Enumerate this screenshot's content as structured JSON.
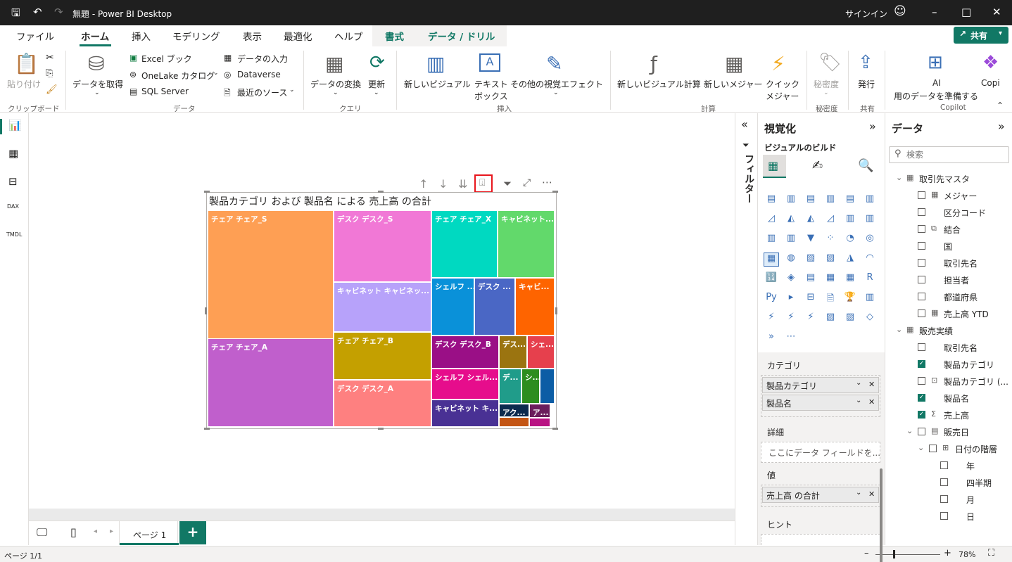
{
  "titlebar": {
    "title": "無題 - Power BI Desktop",
    "signin": "サインイン"
  },
  "menu": {
    "tabs": [
      "ファイル",
      "ホーム",
      "挿入",
      "モデリング",
      "表示",
      "最適化",
      "ヘルプ",
      "書式",
      "データ / ドリル"
    ],
    "share": "共有"
  },
  "ribbon": {
    "clipboard": {
      "paste": "貼り付け",
      "group": "クリップボード"
    },
    "data": {
      "get_data": "データを取得",
      "excel": "Excel ブック",
      "onelake": "OneLake カタログ",
      "sql": "SQL Server",
      "enter": "データの入力",
      "dataverse": "Dataverse",
      "recent": "最近のソース",
      "group": "データ"
    },
    "query": {
      "transform": "データの変換",
      "refresh": "更新",
      "group": "クエリ"
    },
    "insert": {
      "new_visual": "新しいビジュアル",
      "textbox_1": "テキスト",
      "textbox_2": "ボックス",
      "more_visuals": "その他の視覚エフェクト",
      "group": "挿入"
    },
    "calc": {
      "new_calc": "新しいビジュアル計算",
      "new_measure": "新しいメジャー",
      "quick_1": "クイック",
      "quick_2": "メジャー",
      "group": "計算"
    },
    "sens": {
      "label": "秘密度",
      "group": "秘密度"
    },
    "share": {
      "publish": "発行",
      "group": "共有"
    },
    "copilot": {
      "ai_1": "AI",
      "ai_2": "用のデータを準備する",
      "copilot": "Copi",
      "group": "Copilot"
    }
  },
  "visual": {
    "title": "製品カテゴリ および 製品名 による 売上高 の合計"
  },
  "chart_data": {
    "type": "treemap",
    "title": "製品カテゴリ および 製品名 による 売上高 の合計",
    "tiles": [
      {
        "label": "チェア チェア_S",
        "color": "#fe9f54"
      },
      {
        "label": "チェア チェア_A",
        "color": "#c05fcc"
      },
      {
        "label": "デスク デスク_S",
        "color": "#f178d6"
      },
      {
        "label": "キャビネット キャビネッ...",
        "color": "#b7a2fa"
      },
      {
        "label": "チェア チェア_B",
        "color": "#c4a000"
      },
      {
        "label": "デスク デスク_A",
        "color": "#fe8080"
      },
      {
        "label": "チェア チェア_X",
        "color": "#00d9c1"
      },
      {
        "label": "キャビネット...",
        "color": "#62d96b"
      },
      {
        "label": "シェルフ ...",
        "color": "#0a91d9"
      },
      {
        "label": "デスク ...",
        "color": "#4a67c5"
      },
      {
        "label": "キャビ...",
        "color": "#fe6400"
      },
      {
        "label": "デスク デスク_B",
        "color": "#9a0f86"
      },
      {
        "label": "デス...",
        "color": "#9b7410"
      },
      {
        "label": "シェ...",
        "color": "#e6404d"
      },
      {
        "label": "シェルフ シェル...",
        "color": "#e60d8c"
      },
      {
        "label": "デ...",
        "color": "#209c8a"
      },
      {
        "label": "シ...",
        "color": "#2d8d1f"
      },
      {
        "label": "",
        "color": "#0c5da5"
      },
      {
        "label": "キャビネット キ...",
        "color": "#493194"
      },
      {
        "label": "アク...",
        "color": "#0c2a4e"
      },
      {
        "label": "ア...",
        "color": "#6b1d5c"
      },
      {
        "label": "",
        "color": "#c45514"
      },
      {
        "label": "",
        "color": "#b91383"
      }
    ]
  },
  "filters": {
    "label": "フィルター"
  },
  "viz": {
    "title": "視覚化",
    "build": "ビジュアルのビルド",
    "category_label": "カテゴリ",
    "fields": [
      "製品カテゴリ",
      "製品名"
    ],
    "details_label": "詳細",
    "details_placeholder": "ここにデータ フィールドを...",
    "values_label": "値",
    "value_field": "売上高 の合計",
    "tooltip_label": "ヒント"
  },
  "data": {
    "title": "データ",
    "search_placeholder": "検索",
    "tables": [
      {
        "name": "取引先マスタ",
        "fields": [
          {
            "name": "メジャー",
            "checked": false,
            "glyph": "▦"
          },
          {
            "name": "区分コード",
            "checked": false,
            "glyph": ""
          },
          {
            "name": "結合",
            "checked": false,
            "glyph": "⧉"
          },
          {
            "name": "国",
            "checked": false,
            "glyph": ""
          },
          {
            "name": "取引先名",
            "checked": false,
            "glyph": ""
          },
          {
            "name": "担当者",
            "checked": false,
            "glyph": ""
          },
          {
            "name": "都道府県",
            "checked": false,
            "glyph": ""
          },
          {
            "name": "売上高 YTD",
            "checked": false,
            "glyph": "▦"
          }
        ]
      },
      {
        "name": "販売実績",
        "fields": [
          {
            "name": "取引先名",
            "checked": false,
            "glyph": ""
          },
          {
            "name": "製品カテゴリ",
            "checked": true,
            "glyph": ""
          },
          {
            "name": "製品カテゴリ (...",
            "checked": false,
            "glyph": "⊡"
          },
          {
            "name": "製品名",
            "checked": true,
            "glyph": ""
          },
          {
            "name": "売上高",
            "checked": true,
            "glyph": "Σ"
          },
          {
            "name": "販売日",
            "checked": false,
            "glyph": "▤"
          },
          {
            "name": "日付の階層",
            "checked": false,
            "glyph": "⊞"
          },
          {
            "name": "年",
            "checked": false,
            "glyph": ""
          },
          {
            "name": "四半期",
            "checked": false,
            "glyph": ""
          },
          {
            "name": "月",
            "checked": false,
            "glyph": ""
          },
          {
            "name": "日",
            "checked": false,
            "glyph": ""
          }
        ]
      }
    ]
  },
  "pages": {
    "tab": "ページ 1"
  },
  "status": {
    "page": "ページ 1/1",
    "zoom": "78%"
  }
}
